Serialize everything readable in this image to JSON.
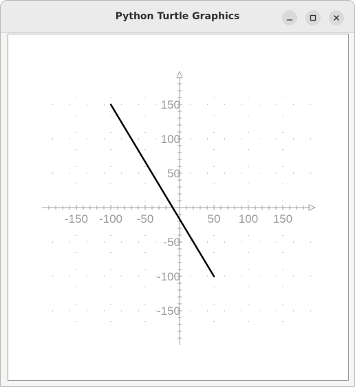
{
  "window": {
    "title": "Python Turtle Graphics",
    "controls": {
      "minimize": "minimize-icon",
      "maximize": "maximize-icon",
      "close": "close-icon"
    }
  },
  "colors": {
    "titlebar": "#ebebeb",
    "axis": "#a0a0a0",
    "tick_label": "#9a9a9a",
    "line": "#000000"
  },
  "chart_data": {
    "type": "line",
    "title": "",
    "xlabel": "",
    "ylabel": "",
    "xlim": [
      -200,
      200
    ],
    "ylim": [
      -200,
      200
    ],
    "grid": true,
    "x_ticks": [
      -150,
      -100,
      -50,
      50,
      100,
      150
    ],
    "y_ticks": [
      150,
      100,
      50,
      -50,
      -100,
      -150
    ],
    "x_tick_labels": [
      "-150",
      "-100",
      "-50",
      "50",
      "100",
      "150"
    ],
    "y_tick_labels": [
      "150",
      "100",
      "50",
      "-50",
      "-100",
      "-150"
    ],
    "series": [
      {
        "points": [
          [
            -100,
            150
          ],
          [
            50,
            -100
          ]
        ],
        "color": "#000000"
      }
    ]
  }
}
